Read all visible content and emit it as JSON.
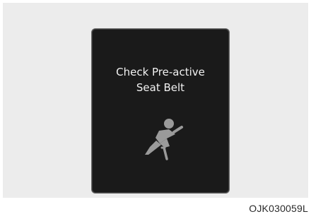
{
  "display": {
    "message_line1": "Check Pre-active",
    "message_line2": "Seat Belt",
    "icon": "seat-belt-warning-icon"
  },
  "caption": "OJK030059L",
  "colors": {
    "screen_background": "#1a1a1a",
    "panel_background": "#ececec",
    "message_text": "#f2f2f2",
    "icon_gray": "#9a9a9a"
  }
}
